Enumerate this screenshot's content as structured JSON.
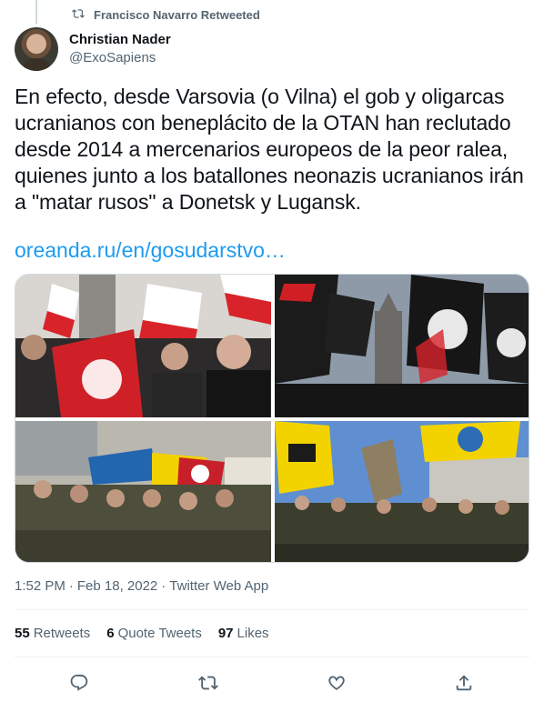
{
  "retweet_context": {
    "label": "Francisco Navarro Retweeted",
    "icon": "retweet-icon"
  },
  "author": {
    "display_name": "Christian Nader",
    "handle": "@ExoSapiens"
  },
  "tweet": {
    "text": "En efecto, desde Varsovia (o Vilna) el gob y oligarcas ucranianos con beneplácito de la OTAN han reclutado desde 2014 a mercenarios europeos de la peor ralea, quienes junto a los batallones neonazis ucranianos irán a \"matar rusos\" a Donetsk y Lugansk.",
    "link_text": "oreanda.ru/en/gosudarstvo…"
  },
  "meta": {
    "time": "1:52 PM",
    "separator": "·",
    "date": "Feb 18, 2022",
    "source": "Twitter Web App"
  },
  "stats": [
    {
      "count": "55",
      "label": "Retweets"
    },
    {
      "count": "6",
      "label": "Quote Tweets"
    },
    {
      "count": "97",
      "label": "Likes"
    }
  ],
  "actions": [
    "reply-icon",
    "retweet-icon",
    "like-icon",
    "share-icon"
  ],
  "colors": {
    "accent": "#1d9bf0",
    "secondary_text": "#536471",
    "divider": "#eff3f4"
  }
}
